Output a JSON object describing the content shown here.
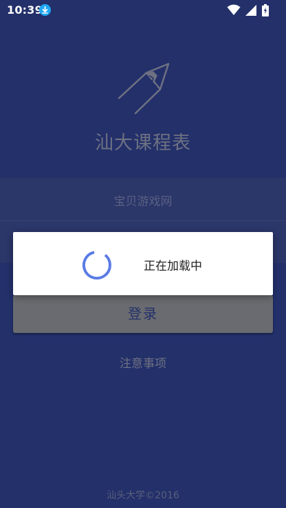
{
  "status_bar": {
    "time": "10:39",
    "icons": [
      "download-icon",
      "wifi-icon",
      "signal-icon",
      "battery-icon"
    ]
  },
  "app": {
    "title": "汕大课程表",
    "logo": "pencil-icon"
  },
  "form": {
    "field_1_value": "宝贝游戏网",
    "field_2_value": "",
    "login_button_label": "登录",
    "notice_link": "注意事项"
  },
  "dialog": {
    "message": "正在加载中"
  },
  "footer": {
    "copyright": "汕头大学©2016"
  },
  "colors": {
    "background": "#23306a",
    "dialog_background": "#ffffff",
    "spinner": "#5b7ce6",
    "login_button": "#6a6b70"
  }
}
